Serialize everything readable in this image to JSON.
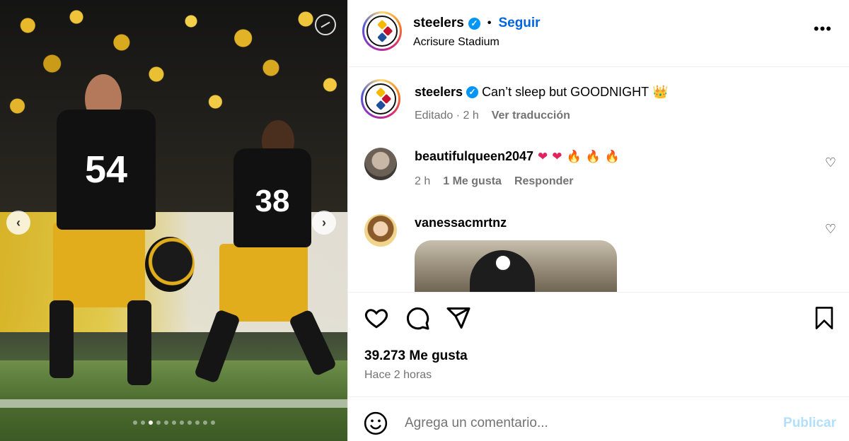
{
  "post": {
    "jersey_a": "54",
    "jersey_b": "38",
    "carousel": {
      "count": 11,
      "active": 2
    }
  },
  "header": {
    "username": "steelers",
    "separator": "•",
    "follow_label": "Seguir",
    "location": "Acrisure Stadium",
    "more_label": "•••",
    "verified_glyph": "✓"
  },
  "caption": {
    "username": "steelers",
    "text": "Can’t sleep but GOODNIGHT",
    "emoji": "👑",
    "edited": "Editado · 2 h",
    "translate": "Ver traducción"
  },
  "comments": [
    {
      "username": "beautifulqueen2047",
      "emojis": [
        "❤",
        "❤",
        "🔥",
        "🔥",
        "🔥"
      ],
      "time": "2 h",
      "likes": "1 Me gusta",
      "reply": "Responder"
    },
    {
      "username": "vanessacmrtnz"
    }
  ],
  "icons": {
    "like": "heart-icon",
    "comment": "comment-icon",
    "share": "share-icon",
    "save": "bookmark-icon",
    "emoji": "smile-icon",
    "comment_like": "♡"
  },
  "stats": {
    "likes": "39.273 Me gusta",
    "posted": "Hace 2 horas"
  },
  "composer": {
    "placeholder": "Agrega un comentario...",
    "publish": "Publicar"
  },
  "colors": {
    "link_blue": "#0064e0",
    "verified_blue": "#0095f6",
    "publish_disabled": "#b2dffc",
    "muted_text": "#737373"
  }
}
